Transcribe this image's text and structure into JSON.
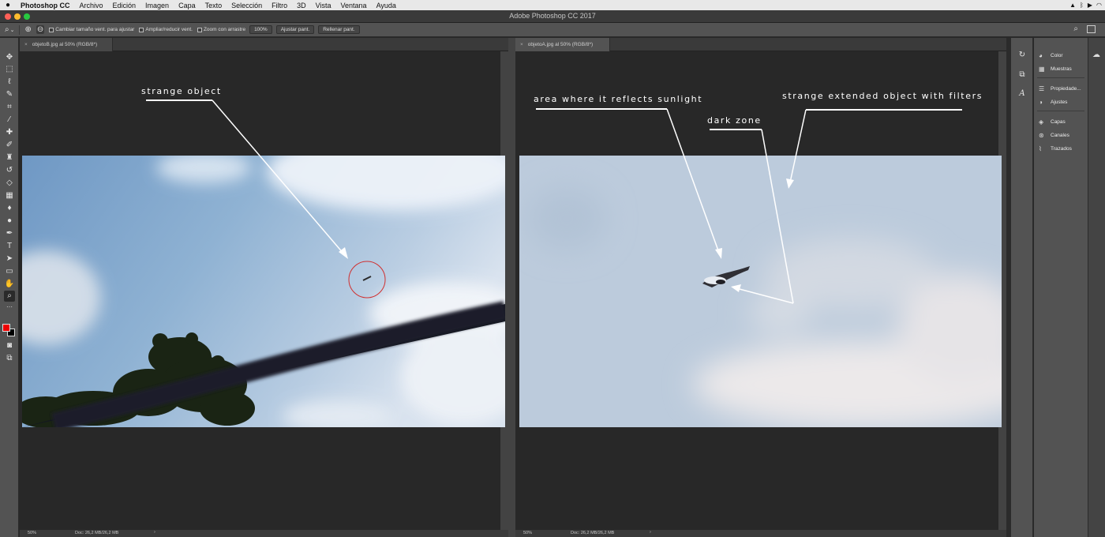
{
  "menubar": {
    "apple": "",
    "items": [
      "Photoshop CC",
      "Archivo",
      "Edición",
      "Imagen",
      "Capa",
      "Texto",
      "Selección",
      "Filtro",
      "3D",
      "Vista",
      "Ventana",
      "Ayuda"
    ],
    "status_icons": [
      "airplay-icon",
      "bluetooth-icon",
      "play-icon",
      "wifi-icon"
    ]
  },
  "window": {
    "title": "Adobe Photoshop CC 2017",
    "traffic_lights": {
      "close": "#fe5f57",
      "minimize": "#febc2e",
      "zoom": "#28c840"
    }
  },
  "options_bar": {
    "tool_icon": "zoom-tool-icon",
    "tool_dropdown": "⌄",
    "zoom_in_icon": "zoom-in-icon",
    "zoom_out_icon": "zoom-out-icon",
    "checkbox_resize": "Cambiar tamaño vent. para ajustar",
    "checkbox_all": "Ampliar/reducir vent.",
    "checkbox_drag": "Zoom con arrastre",
    "zoom_value": "100%",
    "fit_button": "Ajustar pant.",
    "fill_button": "Rellenar pant."
  },
  "tools": [
    "move-tool-icon",
    "marquee-tool-icon",
    "lasso-tool-icon",
    "quick-select-tool-icon",
    "crop-tool-icon",
    "eyedropper-tool-icon",
    "healing-tool-icon",
    "brush-tool-icon",
    "stamp-tool-icon",
    "history-brush-tool-icon",
    "eraser-tool-icon",
    "gradient-tool-icon",
    "dodge-tool-icon",
    "pen-tool-icon",
    "type-tool-icon",
    "path-select-tool-icon",
    "rectangle-tool-icon",
    "hand-tool-icon",
    "zoom-tool-icon"
  ],
  "colors": {
    "foreground": "#ee0000",
    "background": "#000000",
    "annotation": "#ffffff",
    "circle": "#d03030"
  },
  "documents": [
    {
      "tab": "objetoB.jpg al 50% (RGB/8*)",
      "close": "×",
      "zoom": "50%",
      "doc_size": "Doc: 26,2 MB/26,2 MB",
      "annotations": [
        "strange object"
      ]
    },
    {
      "tab": "objetoA.jpg al 50% (RGB/8*)",
      "close": "×",
      "zoom": "50%",
      "doc_size": "Doc: 26,2 MB/26,2 MB",
      "annotations": [
        "area where it reflects sunlight",
        "dark zone",
        "strange extended object with filters"
      ]
    }
  ],
  "dock_icons": [
    "history-icon",
    "artboard-icon",
    "glyphs-icon"
  ],
  "panels": [
    {
      "icon": "color-icon",
      "label": "Color"
    },
    {
      "icon": "swatches-icon",
      "label": "Muestras"
    },
    {
      "icon": "properties-icon",
      "label": "Propiedade..."
    },
    {
      "icon": "adjustments-icon",
      "label": "Ajustes"
    },
    {
      "icon": "layers-icon",
      "label": "Capas"
    },
    {
      "icon": "channels-icon",
      "label": "Canales"
    },
    {
      "icon": "paths-icon",
      "label": "Trazados"
    }
  ],
  "far_right_icon": "libraries-icon",
  "status_arrow": "›"
}
